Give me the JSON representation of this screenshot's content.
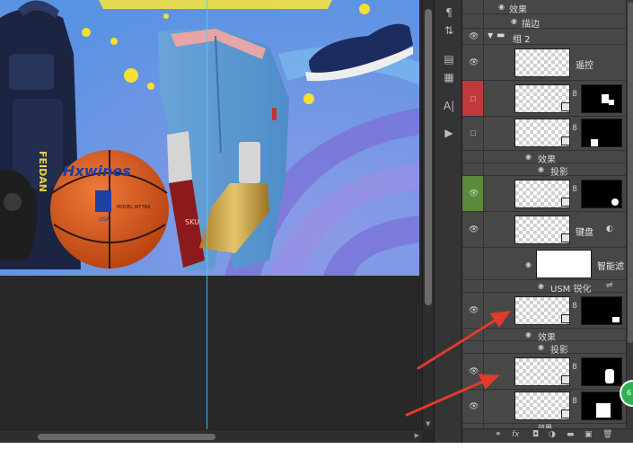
{
  "canvas": {
    "poster_headline": "",
    "basketball_brand": "Hxwines",
    "basketball_model": "MODEL WF7B8",
    "basketball_tag": "USA",
    "bottle_label": "SKU",
    "backpack_brand": "FEIDAN"
  },
  "tools": {
    "icons": [
      "paragraph-icon",
      "character-icon",
      "notes-icon",
      "text-icon",
      "play-icon"
    ]
  },
  "layers": {
    "rows": [
      {
        "kind": "effects",
        "label": "效果"
      },
      {
        "kind": "effect",
        "label": "描边"
      },
      {
        "kind": "group",
        "label": "组 2"
      },
      {
        "kind": "layer",
        "label": "遥控"
      },
      {
        "kind": "layer",
        "label": "",
        "eye_color": "#c0393b"
      },
      {
        "kind": "layer",
        "label": ""
      },
      {
        "kind": "effects",
        "label": "效果"
      },
      {
        "kind": "effect",
        "label": "投影"
      },
      {
        "kind": "layer",
        "label": "",
        "eye_color": "#5b8a3c"
      },
      {
        "kind": "layer",
        "label": "键盘"
      },
      {
        "kind": "filter",
        "label": "智能滤"
      },
      {
        "kind": "filter-effect",
        "label": "USM 锐化"
      },
      {
        "kind": "layer",
        "label": ""
      },
      {
        "kind": "effects",
        "label": "效果"
      },
      {
        "kind": "effect",
        "label": "投影"
      },
      {
        "kind": "layer",
        "label": ""
      },
      {
        "kind": "layer",
        "label": ""
      },
      {
        "kind": "effects",
        "label": "效果"
      }
    ]
  },
  "bottom_bar": {
    "icons": [
      "link-icon",
      "fx-icon",
      "mask-icon",
      "adjustment-icon",
      "folder-icon",
      "new-layer-icon",
      "trash-icon"
    ],
    "fx_label": "fx"
  },
  "badge": {
    "label": "6"
  },
  "colors": {
    "annotation_arrow": "#e03b2c",
    "guide": "#58c8ff",
    "panel_bg": "#474747"
  }
}
